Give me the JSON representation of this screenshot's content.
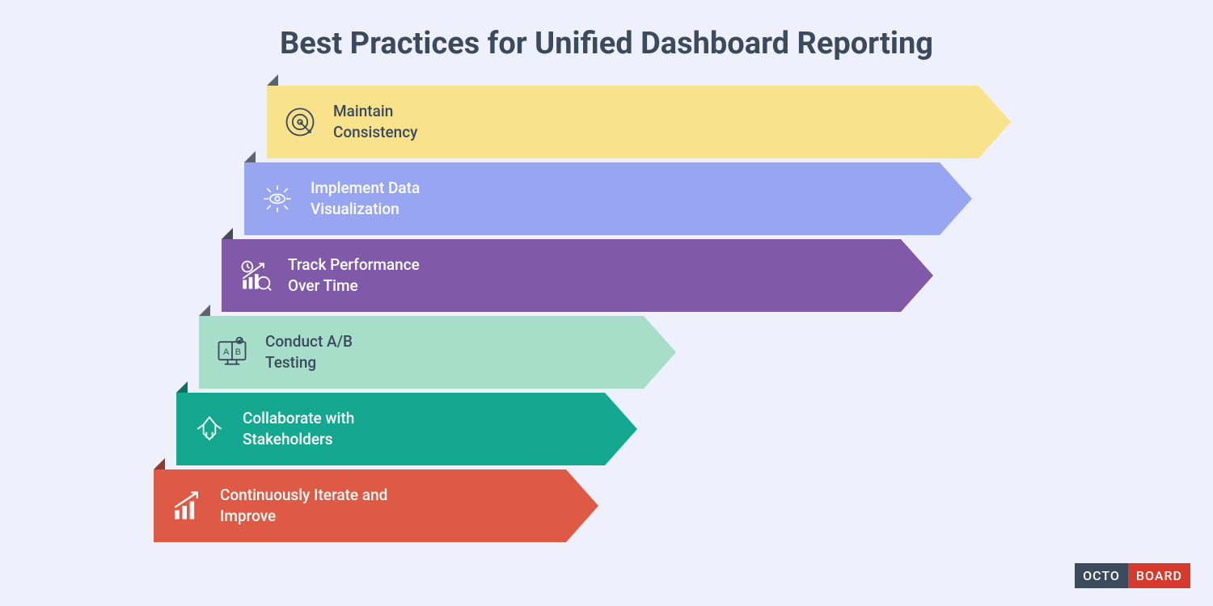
{
  "title": "Best Practices for Unified Dashboard Reporting",
  "items": [
    {
      "line1": "Maintain",
      "line2": "Consistency",
      "color": "#f8e28b",
      "textColor": "#3b4a5c",
      "icon": "target-icon"
    },
    {
      "line1": "Implement Data",
      "line2": "Visualization",
      "color": "#98a6f2",
      "textColor": "#ffffff",
      "icon": "eye-focus-icon"
    },
    {
      "line1": "Track Performance",
      "line2": "Over Time",
      "color": "#8059a8",
      "textColor": "#ffffff",
      "icon": "chart-clock-icon"
    },
    {
      "line1": "Conduct A/B",
      "line2": "Testing",
      "color": "#a6dec9",
      "textColor": "#3b4a5c",
      "icon": "ab-test-icon"
    },
    {
      "line1": "Collaborate with",
      "line2": "Stakeholders",
      "color": "#13a88f",
      "textColor": "#ffffff",
      "icon": "hands-icon"
    },
    {
      "line1": "Continuously Iterate and",
      "line2": "Improve",
      "color": "#de5a44",
      "textColor": "#ffffff",
      "icon": "growth-icon"
    }
  ],
  "logo": {
    "left": "OCTO",
    "right": "BOARD"
  }
}
